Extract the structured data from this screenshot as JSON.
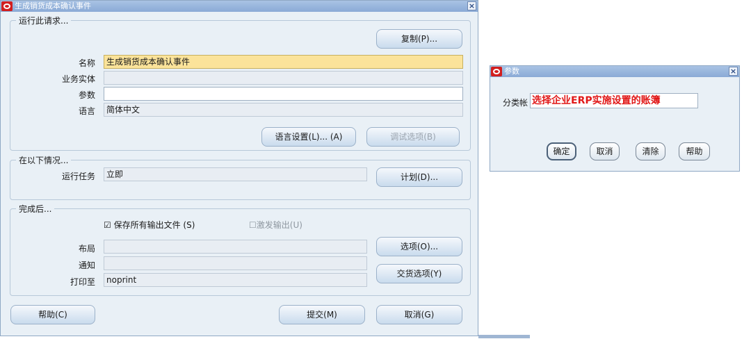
{
  "main_window": {
    "title": "生成销货成本确认事件",
    "close": "×",
    "run_request": {
      "group_label": "运行此请求...",
      "copy_button": "复制(P)...",
      "name_label": "名称",
      "name_value": "生成销货成本确认事件",
      "operating_unit_label": "业务实体",
      "operating_unit_value": "",
      "parameters_label": "参数",
      "parameters_value": "",
      "language_label": "语言",
      "language_value": "简体中文",
      "language_settings_button": "语言设置(L)... (A)",
      "debug_options_button": "调试选项(B)"
    },
    "schedule": {
      "group_label": "在以下情况...",
      "run_job_label": "运行任务",
      "run_job_value": "立即",
      "schedule_button": "计划(D)..."
    },
    "completion": {
      "group_label": "完成后...",
      "save_output_label": "保存所有输出文件 (S)",
      "save_output_checked": true,
      "burst_output_label": "激发输出(U)",
      "burst_output_checked": false,
      "layout_label": "布局",
      "layout_value": "",
      "notify_label": "通知",
      "notify_value": "",
      "print_to_label": "打印至",
      "print_to_value": "noprint",
      "options_button": "选项(O)...",
      "delivery_options_button": "交货选项(Y)"
    },
    "footer": {
      "help_button": "帮助(C)",
      "submit_button": "提交(M)",
      "cancel_button": "取消(G)"
    }
  },
  "params_window": {
    "title": "参数",
    "close": "×",
    "ledger_label": "分类帐",
    "ledger_hint": "选择企业ERP实施设置的账簿",
    "ok_button": "确定",
    "cancel_button": "取消",
    "clear_button": "清除",
    "help_button": "帮助"
  }
}
